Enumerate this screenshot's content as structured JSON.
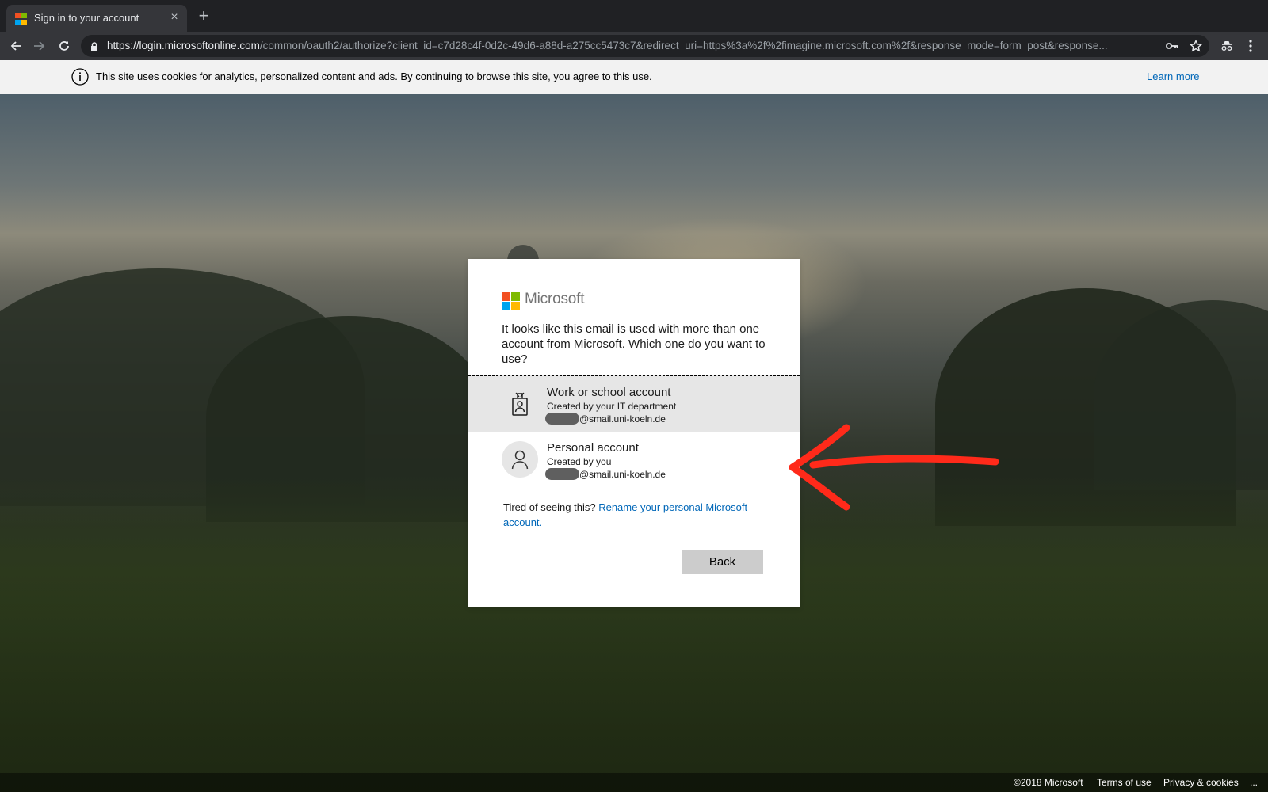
{
  "browser": {
    "tab_title": "Sign in to your account",
    "tab_close": "×",
    "new_tab": "+",
    "url_host": "https://login.microsoftonline.com",
    "url_path": "/common/oauth2/authorize?client_id=c7d28c4f-0d2c-49d6-a88d-a275cc5473c7&redirect_uri=https%3a%2f%2fimagine.microsoft.com%2f&response_mode=form_post&response..."
  },
  "cookie_banner": {
    "text": "This site uses cookies for analytics, personalized content and ads. By continuing to browse this site, you agree to this use.",
    "link": "Learn more"
  },
  "dialog": {
    "brand": "Microsoft",
    "question": "It looks like this email is used with more than one account from Microsoft. Which one do you want to use?",
    "accounts": [
      {
        "title": "Work or school account",
        "subtitle": "Created by your IT department",
        "email_suffix": "@smail.uni-koeln.de",
        "icon": "badge-icon"
      },
      {
        "title": "Personal account",
        "subtitle": "Created by you",
        "email_suffix": "@smail.uni-koeln.de",
        "icon": "person-icon"
      }
    ],
    "tired_text": "Tired of seeing this? ",
    "rename_link": "Rename your personal Microsoft account.",
    "back_label": "Back"
  },
  "footer": {
    "copyright": "©2018 Microsoft",
    "terms": "Terms of use",
    "privacy": "Privacy & cookies",
    "more": "..."
  },
  "colors": {
    "ms_red": "#f25022",
    "ms_green": "#7fba00",
    "ms_blue": "#00a4ef",
    "ms_yellow": "#ffb900",
    "link_blue": "#0067b8",
    "annotation_red": "#ff2a1a"
  }
}
